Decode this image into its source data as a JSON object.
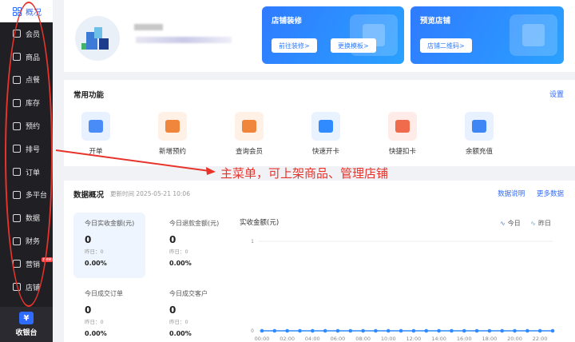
{
  "sidebar": {
    "overview": "概况",
    "items": [
      {
        "label": "会员",
        "icon": "member-icon"
      },
      {
        "label": "商品",
        "icon": "goods-icon"
      },
      {
        "label": "点餐",
        "icon": "ordering-icon"
      },
      {
        "label": "库存",
        "icon": "inventory-icon"
      },
      {
        "label": "预约",
        "icon": "reservation-icon"
      },
      {
        "label": "排号",
        "icon": "queue-icon"
      },
      {
        "label": "订单",
        "icon": "order-icon"
      },
      {
        "label": "多平台",
        "icon": "multi-platform-icon"
      },
      {
        "label": "数据",
        "icon": "data-icon"
      },
      {
        "label": "财务",
        "icon": "finance-icon"
      },
      {
        "label": "营销",
        "icon": "marketing-icon",
        "badge": "new"
      },
      {
        "label": "店铺",
        "icon": "shop-icon"
      }
    ],
    "cashier": "收银台"
  },
  "promo": {
    "decorate": {
      "title": "店铺装修",
      "btn1": "前往装修>",
      "btn2": "更换模板>"
    },
    "preview": {
      "title": "预览店铺",
      "btn": "店铺二维码>"
    }
  },
  "common": {
    "title": "常用功能",
    "setting": "设置",
    "functions": [
      {
        "label": "开单",
        "color": "#4a8cf7",
        "bg": "#e8f1ff"
      },
      {
        "label": "新增预约",
        "color": "#f0853c",
        "bg": "#fff1e6"
      },
      {
        "label": "查询会员",
        "color": "#f0853c",
        "bg": "#fff1e6"
      },
      {
        "label": "快速开卡",
        "color": "#2f8bff",
        "bg": "#e8f3ff"
      },
      {
        "label": "快捷扣卡",
        "color": "#f06a4c",
        "bg": "#ffece8"
      },
      {
        "label": "余额充值",
        "color": "#3e86f5",
        "bg": "#e8f1ff"
      }
    ]
  },
  "annotation": "主菜单，可上架商品、管理店铺",
  "data": {
    "title": "数据概况",
    "updated": "更新时间 2025-05-21 10:06",
    "link_explain": "数据说明",
    "link_more": "更多数据",
    "stats": [
      {
        "label": "今日实收金额(元)",
        "value": "0",
        "yesterday": "昨日：0",
        "pct": "0.00%"
      },
      {
        "label": "今日退款金额(元)",
        "value": "0",
        "yesterday": "昨日：0",
        "pct": "0.00%"
      },
      {
        "label": "今日成交订单",
        "value": "0",
        "yesterday": "昨日：0",
        "pct": "0.00%"
      },
      {
        "label": "今日成交客户",
        "value": "0",
        "yesterday": "昨日：0",
        "pct": "0.00%"
      }
    ],
    "chart_title": "实收金额(元)",
    "legend_today": "今日",
    "legend_yesterday": "昨日"
  },
  "chart_data": {
    "type": "line",
    "x": [
      "00:00",
      "02:00",
      "04:00",
      "06:00",
      "08:00",
      "10:00",
      "12:00",
      "14:00",
      "16:00",
      "18:00",
      "20:00",
      "22:00"
    ],
    "yticks": [
      "0",
      "1"
    ],
    "ylim": [
      0,
      1
    ],
    "series": [
      {
        "name": "今日",
        "values": [
          0,
          0,
          0,
          0,
          0,
          0,
          0,
          0,
          0,
          0,
          0,
          0,
          0,
          0,
          0,
          0,
          0,
          0,
          0,
          0,
          0,
          0,
          0,
          0
        ]
      }
    ]
  },
  "colors": {
    "accent": "#2f6bff",
    "annotation": "#e8332b",
    "sidebar": "#1f1f24"
  }
}
